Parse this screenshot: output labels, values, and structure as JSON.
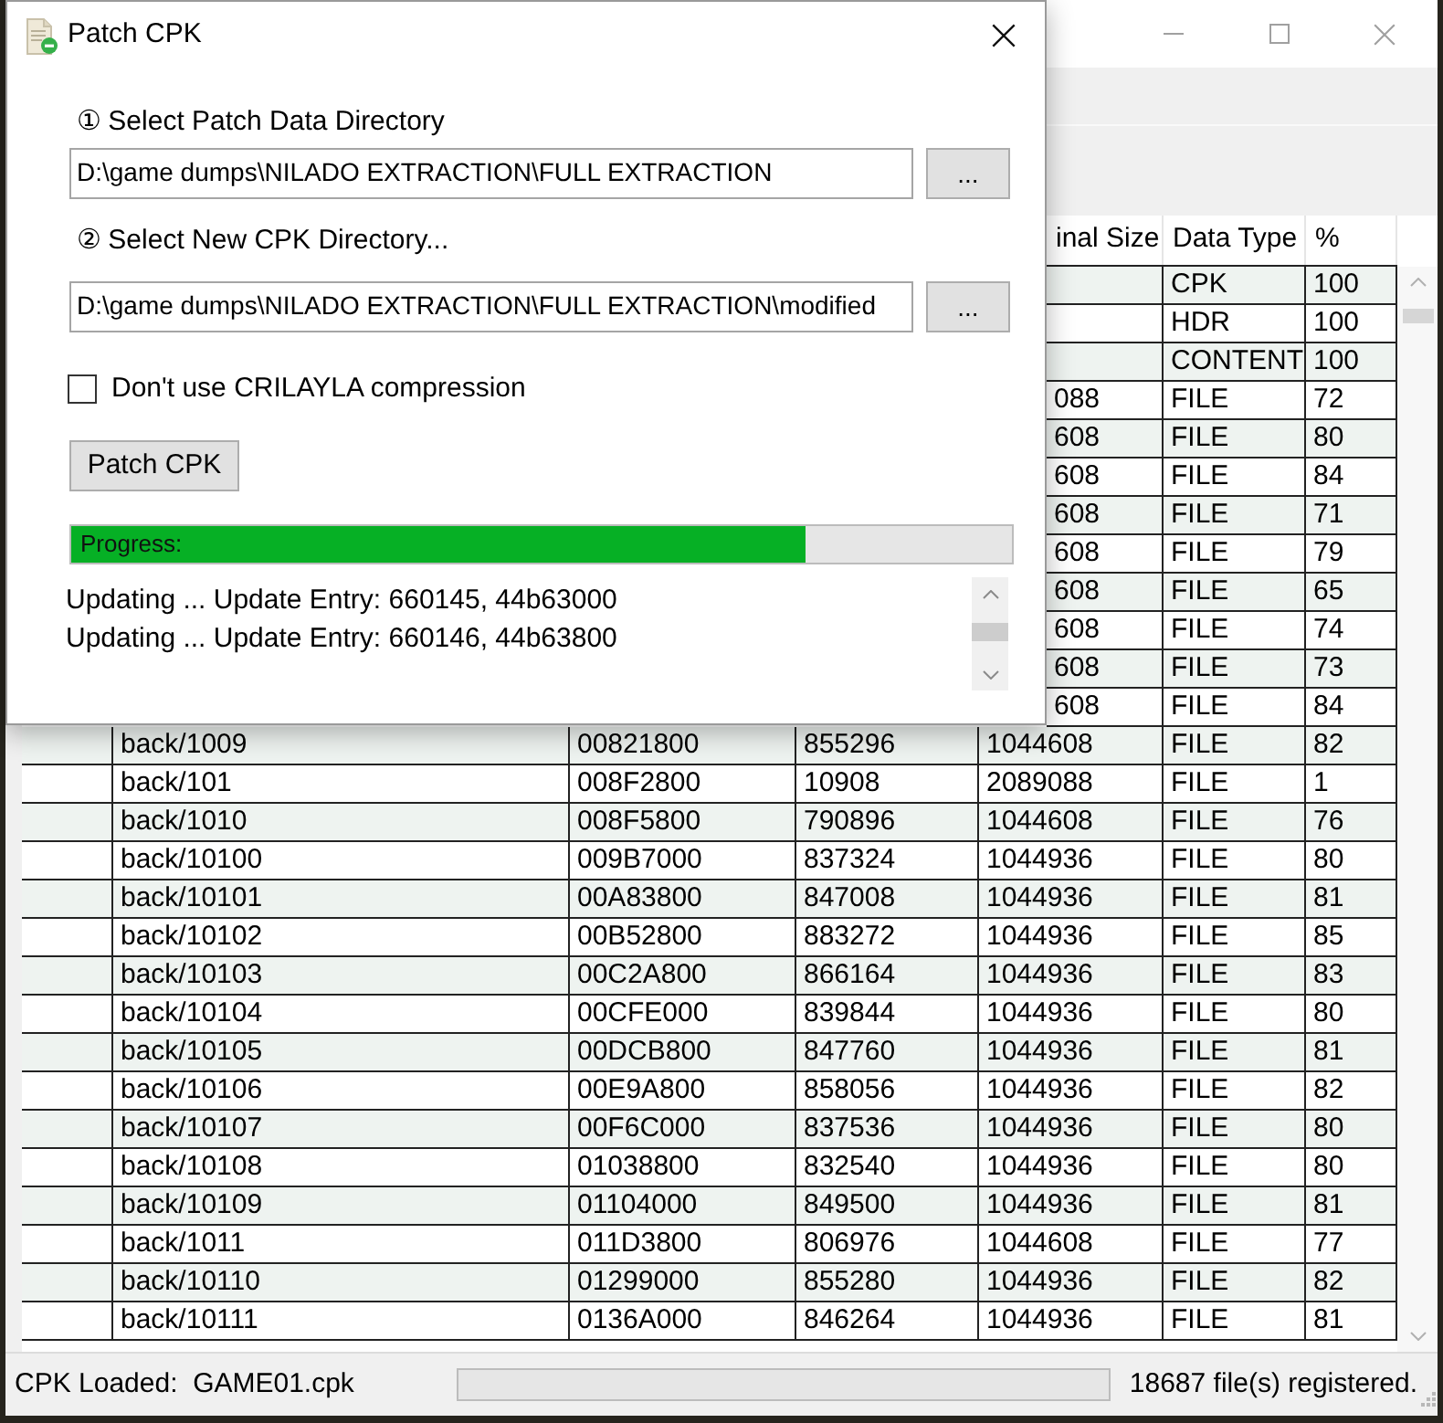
{
  "dialog": {
    "title": "Patch CPK",
    "fields": [
      {
        "label": "① Select Patch Data Directory",
        "value": "D:\\game dumps\\NILADO EXTRACTION\\FULL EXTRACTION",
        "button": "..."
      },
      {
        "label": "② Select New CPK Directory...",
        "value": "D:\\game dumps\\NILADO EXTRACTION\\FULL EXTRACTION\\modified",
        "button": "..."
      }
    ],
    "checkbox": {
      "label": "Don't use CRILAYLA compression",
      "checked": false
    },
    "patch_button": "Patch CPK",
    "progress": {
      "label": "Progress:",
      "level": 0.78
    },
    "log": [
      "Updating ... Update Entry: 660145, 44b63000",
      "Updating ... Update Entry: 660146, 44b63800"
    ]
  },
  "main_window": {
    "table": {
      "header": {
        "column_5": "inal Size",
        "column_6": "Data Type",
        "column_7": "%"
      },
      "rows": [
        {
          "column_6": "CPK",
          "column_7": "100"
        },
        {
          "column_6": "HDR",
          "column_7": "100"
        },
        {
          "column_6": "CONTENT",
          "column_7": "100"
        },
        {
          "column_5": "088",
          "column_6": "FILE",
          "column_7": "72"
        },
        {
          "column_5": "608",
          "column_6": "FILE",
          "column_7": "80"
        },
        {
          "column_5": "608",
          "column_6": "FILE",
          "column_7": "84"
        },
        {
          "column_5": "608",
          "column_6": "FILE",
          "column_7": "71"
        },
        {
          "column_5": "608",
          "column_6": "FILE",
          "column_7": "79"
        },
        {
          "column_5": "608",
          "column_6": "FILE",
          "column_7": "65"
        },
        {
          "column_5": "608",
          "column_6": "FILE",
          "column_7": "74"
        },
        {
          "column_5": "608",
          "column_6": "FILE",
          "column_7": "73"
        },
        {
          "column_5": "608",
          "column_6": "FILE",
          "column_7": "84"
        },
        {
          "column_2": "back/1009",
          "column_3": "00821800",
          "column_4": "855296",
          "column_5": "1044608",
          "column_6": "FILE",
          "column_7": "82"
        },
        {
          "column_2": "back/101",
          "column_3": "008F2800",
          "column_4": "10908",
          "column_5": "2089088",
          "column_6": "FILE",
          "column_7": "1"
        },
        {
          "column_2": "back/1010",
          "column_3": "008F5800",
          "column_4": "790896",
          "column_5": "1044608",
          "column_6": "FILE",
          "column_7": "76"
        },
        {
          "column_2": "back/10100",
          "column_3": "009B7000",
          "column_4": "837324",
          "column_5": "1044936",
          "column_6": "FILE",
          "column_7": "80"
        },
        {
          "column_2": "back/10101",
          "column_3": "00A83800",
          "column_4": "847008",
          "column_5": "1044936",
          "column_6": "FILE",
          "column_7": "81"
        },
        {
          "column_2": "back/10102",
          "column_3": "00B52800",
          "column_4": "883272",
          "column_5": "1044936",
          "column_6": "FILE",
          "column_7": "85"
        },
        {
          "column_2": "back/10103",
          "column_3": "00C2A800",
          "column_4": "866164",
          "column_5": "1044936",
          "column_6": "FILE",
          "column_7": "83"
        },
        {
          "column_2": "back/10104",
          "column_3": "00CFE000",
          "column_4": "839844",
          "column_5": "1044936",
          "column_6": "FILE",
          "column_7": "80"
        },
        {
          "column_2": "back/10105",
          "column_3": "00DCB800",
          "column_4": "847760",
          "column_5": "1044936",
          "column_6": "FILE",
          "column_7": "81"
        },
        {
          "column_2": "back/10106",
          "column_3": "00E9A800",
          "column_4": "858056",
          "column_5": "1044936",
          "column_6": "FILE",
          "column_7": "82"
        },
        {
          "column_2": "back/10107",
          "column_3": "00F6C000",
          "column_4": "837536",
          "column_5": "1044936",
          "column_6": "FILE",
          "column_7": "80"
        },
        {
          "column_2": "back/10108",
          "column_3": "01038800",
          "column_4": "832540",
          "column_5": "1044936",
          "column_6": "FILE",
          "column_7": "80"
        },
        {
          "column_2": "back/10109",
          "column_3": "01104000",
          "column_4": "849500",
          "column_5": "1044936",
          "column_6": "FILE",
          "column_7": "81"
        },
        {
          "column_2": "back/1011",
          "column_3": "011D3800",
          "column_4": "806976",
          "column_5": "1044608",
          "column_6": "FILE",
          "column_7": "77"
        },
        {
          "column_2": "back/10110",
          "column_3": "01299000",
          "column_4": "855280",
          "column_5": "1044936",
          "column_6": "FILE",
          "column_7": "82"
        },
        {
          "column_2": "back/10111",
          "column_3": "0136A000",
          "column_4": "846264",
          "column_5": "1044936",
          "column_6": "FILE",
          "column_7": "81"
        }
      ]
    },
    "status_bar": {
      "loaded": "CPK Loaded:  GAME01.cpk",
      "count": "18687 file(s) registered."
    }
  }
}
